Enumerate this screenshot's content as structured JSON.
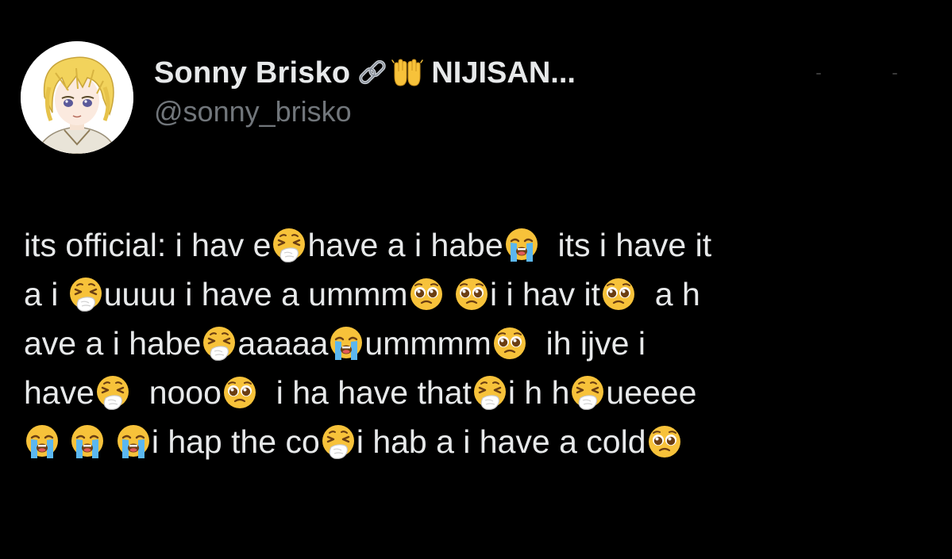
{
  "tweet": {
    "author": {
      "display_name": "Sonny Brisko",
      "name_suffix": "NIJISAN...",
      "handle": "@sonny_brisko",
      "badges": [
        "link-icon",
        "raised-hands-icon"
      ]
    },
    "lines": [
      [
        {
          "t": "its official: i hav e"
        },
        {
          "e": "sneezing-face-icon"
        },
        {
          "t": "have a i habe"
        },
        {
          "e": "loudly-crying-face-icon"
        },
        {
          "t": "  its i have it"
        }
      ],
      [
        {
          "t": "a i "
        },
        {
          "e": "sneezing-face-icon"
        },
        {
          "t": "uuuu i have a ummm"
        },
        {
          "e": "pleading-face-icon"
        },
        {
          "t": " "
        },
        {
          "e": "pleading-face-icon"
        },
        {
          "t": "i i hav it"
        },
        {
          "e": "pleading-face-icon"
        },
        {
          "t": "  a h"
        }
      ],
      [
        {
          "t": "ave a i habe"
        },
        {
          "e": "sneezing-face-icon"
        },
        {
          "t": "aaaaa"
        },
        {
          "e": "loudly-crying-face-icon"
        },
        {
          "t": "ummmm"
        },
        {
          "e": "pleading-face-icon"
        },
        {
          "t": "  ih ijve i"
        }
      ],
      [
        {
          "t": "have"
        },
        {
          "e": "sneezing-face-icon"
        },
        {
          "t": "  nooo"
        },
        {
          "e": "pleading-face-icon"
        },
        {
          "t": "  i ha have that"
        },
        {
          "e": "sneezing-face-icon"
        },
        {
          "t": "i h h"
        },
        {
          "e": "sneezing-face-icon"
        },
        {
          "t": "ueeee"
        }
      ],
      [
        {
          "e": "loudly-crying-face-icon"
        },
        {
          "t": " "
        },
        {
          "e": "loudly-crying-face-icon"
        },
        {
          "t": " "
        },
        {
          "e": "loudly-crying-face-icon"
        },
        {
          "t": "i hap the co"
        },
        {
          "e": "sneezing-face-icon"
        },
        {
          "t": "i hab a i have a cold"
        },
        {
          "e": "pleading-face-icon"
        }
      ]
    ]
  },
  "colors": {
    "background": "#000000",
    "primary_text": "#e7e9ea",
    "secondary_text": "#71767b",
    "emoji_yellow": "#f7c23a"
  }
}
